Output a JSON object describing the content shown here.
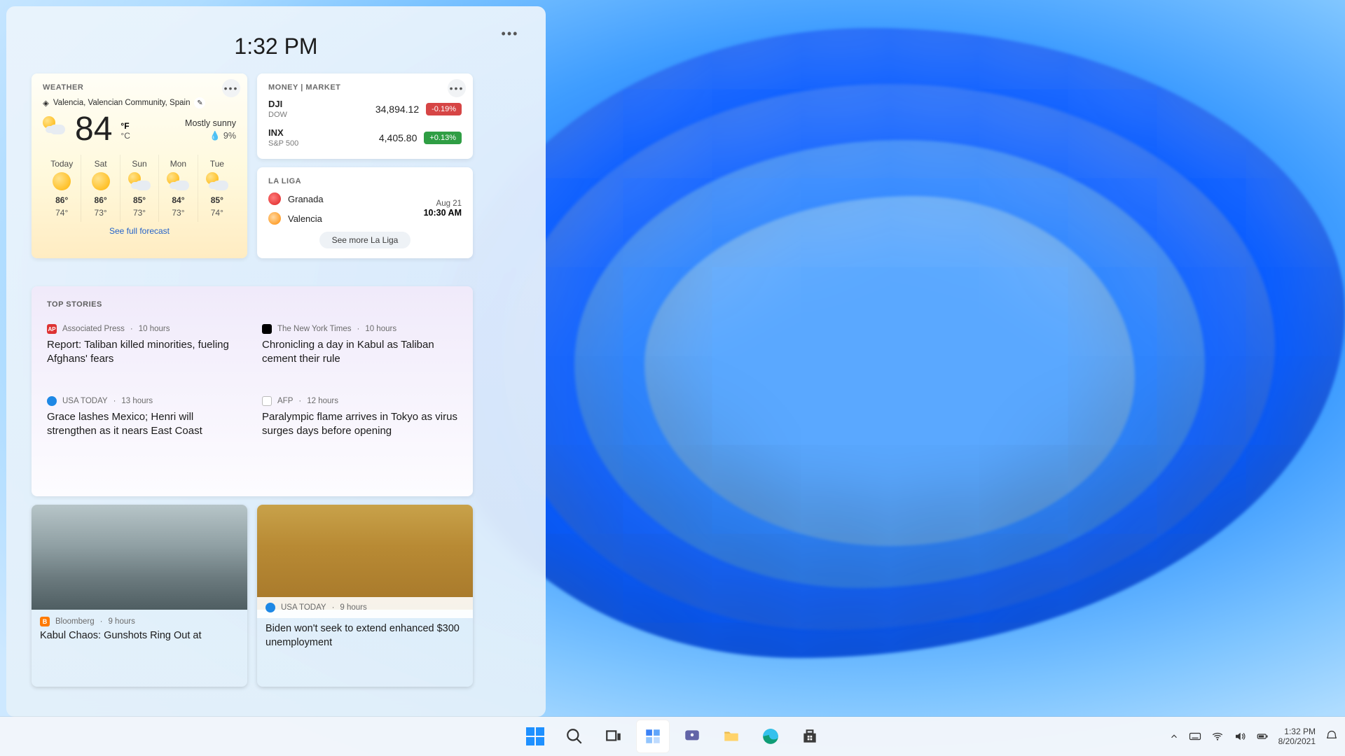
{
  "panel": {
    "time": "1:32 PM"
  },
  "weather": {
    "title": "WEATHER",
    "location": "Valencia, Valencian Community, Spain",
    "temp": "84",
    "unit_f": "°F",
    "unit_c": "°C",
    "condition": "Mostly sunny",
    "humidity": "9%",
    "see_full": "See full forecast",
    "days": [
      {
        "name": "Today",
        "icon": "sun",
        "hi": "86°",
        "lo": "74°"
      },
      {
        "name": "Sat",
        "icon": "sun",
        "hi": "86°",
        "lo": "73°"
      },
      {
        "name": "Sun",
        "icon": "sun-cloud",
        "hi": "85°",
        "lo": "73°"
      },
      {
        "name": "Mon",
        "icon": "sun-cloud",
        "hi": "84°",
        "lo": "73°"
      },
      {
        "name": "Tue",
        "icon": "sun-cloud",
        "hi": "85°",
        "lo": "74°"
      }
    ]
  },
  "money": {
    "title": "MONEY | MARKET",
    "rows": [
      {
        "sym": "DJI",
        "name": "DOW",
        "price": "34,894.12",
        "change": "-0.19%",
        "dir": "neg"
      },
      {
        "sym": "INX",
        "name": "S&P 500",
        "price": "4,405.80",
        "change": "+0.13%",
        "dir": "pos"
      }
    ]
  },
  "laliga": {
    "title": "LA LIGA",
    "teams": [
      {
        "name": "Granada",
        "badge": "tb-red"
      },
      {
        "name": "Valencia",
        "badge": "tb-org"
      }
    ],
    "date": "Aug 21",
    "time": "10:30 AM",
    "see_more": "See more La Liga"
  },
  "stories": {
    "title": "TOP STORIES",
    "items": [
      {
        "src": "Associated Press",
        "badge": "sb-ap",
        "age": "10 hours",
        "title": "Report: Taliban killed minorities, fueling Afghans' fears"
      },
      {
        "src": "The New York Times",
        "badge": "sb-nyt",
        "age": "10 hours",
        "title": "Chronicling a day in Kabul as Taliban cement their rule"
      },
      {
        "src": "USA TODAY",
        "badge": "sb-usa",
        "age": "13 hours",
        "title": "Grace lashes Mexico; Henri will strengthen as it nears East Coast"
      },
      {
        "src": "AFP",
        "badge": "sb-afp",
        "age": "12 hours",
        "title": "Paralympic flame arrives in Tokyo as virus surges days before opening"
      }
    ]
  },
  "news": {
    "items": [
      {
        "src": "Bloomberg",
        "age": "9 hours",
        "title": "Kabul Chaos: Gunshots Ring Out at"
      },
      {
        "src": "USA TODAY",
        "age": "9 hours",
        "title": "Biden won't seek to extend enhanced $300 unemployment"
      }
    ]
  },
  "taskbar": {
    "time": "1:32 PM",
    "date": "8/20/2021"
  }
}
